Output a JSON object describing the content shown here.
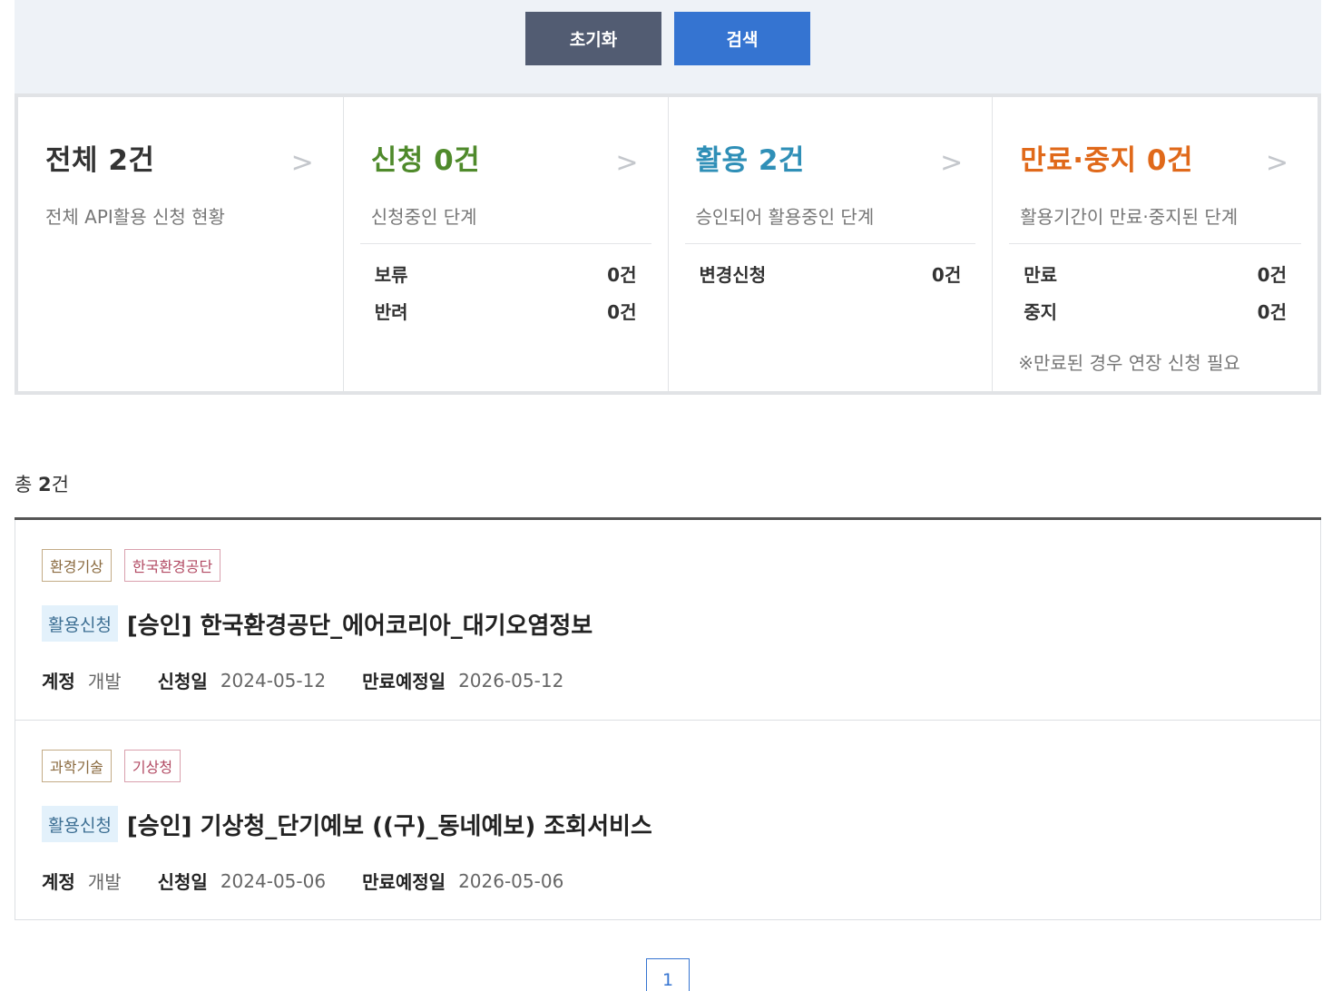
{
  "search": {
    "reset_label": "초기화",
    "search_label": "검색"
  },
  "summary": {
    "total": {
      "title": "전체 2건",
      "desc": "전체 API활용 신청 현황",
      "arrow": ">"
    },
    "apply": {
      "title": "신청 0건",
      "desc": "신청중인 단계",
      "arrow": ">",
      "rows": [
        {
          "label": "보류",
          "value": "0건"
        },
        {
          "label": "반려",
          "value": "0건"
        }
      ]
    },
    "use": {
      "title": "활용 2건",
      "desc": "승인되어 활용중인 단계",
      "arrow": ">",
      "rows": [
        {
          "label": "변경신청",
          "value": "0건"
        }
      ]
    },
    "expire": {
      "title": "만료·중지 0건",
      "desc": "활용기간이 만료·중지된 단계",
      "arrow": ">",
      "rows": [
        {
          "label": "만료",
          "value": "0건"
        },
        {
          "label": "중지",
          "value": "0건"
        }
      ],
      "note": "※만료된 경우 연장 신청 필요"
    }
  },
  "list": {
    "count_prefix": "총 ",
    "count": "2",
    "count_suffix": "건",
    "items": [
      {
        "category": "환경기상",
        "org": "한국환경공단",
        "status": "활용신청",
        "title": "[승인] 한국환경공단_에어코리아_대기오염정보",
        "account_label": "계정",
        "account": "개발",
        "apply_label": "신청일",
        "apply_date": "2024-05-12",
        "expire_label": "만료예정일",
        "expire_date": "2026-05-12"
      },
      {
        "category": "과학기술",
        "org": "기상청",
        "status": "활용신청",
        "title": "[승인] 기상청_단기예보 ((구)_동네예보) 조회서비스",
        "account_label": "계정",
        "account": "개발",
        "apply_label": "신청일",
        "apply_date": "2024-05-06",
        "expire_label": "만료예정일",
        "expire_date": "2026-05-06"
      }
    ]
  },
  "pagination": {
    "current": "1"
  },
  "colors": {
    "apply": "#4f8a2b",
    "use": "#2f8fb7",
    "expire": "#e0691a",
    "primary": "#3574d1",
    "reset": "#525c72"
  }
}
